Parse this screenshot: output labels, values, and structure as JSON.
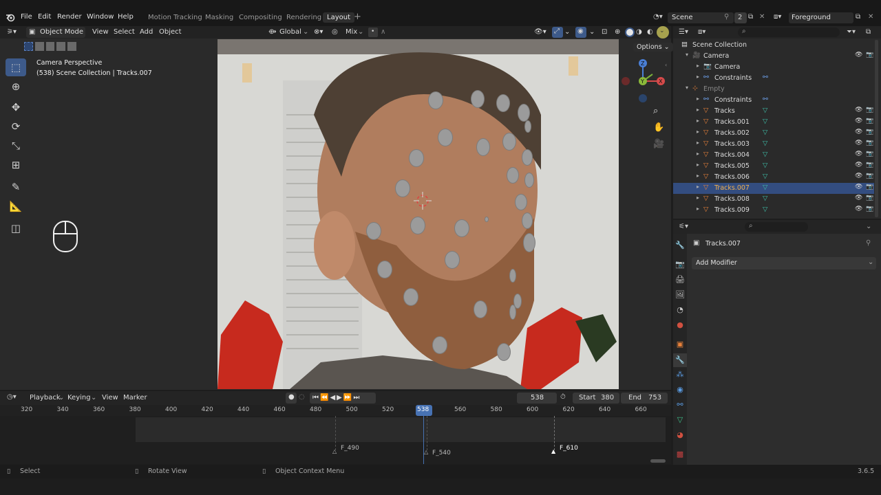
{
  "menu": [
    "File",
    "Edit",
    "Render",
    "Window",
    "Help"
  ],
  "workspaces": [
    "Motion Tracking",
    "Masking",
    "Compositing",
    "Rendering",
    "Layout"
  ],
  "active_workspace": "Layout",
  "scene": {
    "name": "Scene",
    "users": "2"
  },
  "view_layer": "Foreground",
  "viewport_header": {
    "mode": "Object Mode",
    "view": "View",
    "select": "Select",
    "add": "Add",
    "object": "Object",
    "transform_orientation": "Global",
    "pivot_mix": "Mix",
    "options": "Options"
  },
  "viewport_overlay": {
    "title": "Camera Perspective",
    "subtitle": "(538) Scene Collection | Tracks.007"
  },
  "outliner": {
    "rows": [
      {
        "label": "Scene Collection",
        "indent": 0,
        "icon": "collection-icon",
        "selected": false,
        "muted": false
      },
      {
        "label": "Camera",
        "indent": 1,
        "icon": "camera-object-icon",
        "selected": false,
        "muted": false
      },
      {
        "label": "Camera",
        "indent": 2,
        "icon": "camera-data-icon",
        "selected": false,
        "muted": false
      },
      {
        "label": "Constraints",
        "indent": 2,
        "icon": "constraint-icon",
        "selected": false,
        "muted": false
      },
      {
        "label": "Empty",
        "indent": 1,
        "icon": "empty-icon",
        "selected": false,
        "muted": true
      },
      {
        "label": "Constraints",
        "indent": 2,
        "icon": "constraint-icon",
        "selected": false,
        "muted": false
      },
      {
        "label": "Tracks",
        "indent": 2,
        "icon": "mesh-icon",
        "selected": false,
        "muted": false
      },
      {
        "label": "Tracks.001",
        "indent": 2,
        "icon": "mesh-icon",
        "selected": false,
        "muted": false
      },
      {
        "label": "Tracks.002",
        "indent": 2,
        "icon": "mesh-icon",
        "selected": false,
        "muted": false
      },
      {
        "label": "Tracks.003",
        "indent": 2,
        "icon": "mesh-icon",
        "selected": false,
        "muted": false
      },
      {
        "label": "Tracks.004",
        "indent": 2,
        "icon": "mesh-icon",
        "selected": false,
        "muted": false
      },
      {
        "label": "Tracks.005",
        "indent": 2,
        "icon": "mesh-icon",
        "selected": false,
        "muted": false
      },
      {
        "label": "Tracks.006",
        "indent": 2,
        "icon": "mesh-icon",
        "selected": false,
        "muted": false
      },
      {
        "label": "Tracks.007",
        "indent": 2,
        "icon": "mesh-icon",
        "selected": true,
        "muted": false
      },
      {
        "label": "Tracks.008",
        "indent": 2,
        "icon": "mesh-icon",
        "selected": false,
        "muted": false
      },
      {
        "label": "Tracks.009",
        "indent": 2,
        "icon": "mesh-icon",
        "selected": false,
        "muted": false
      }
    ]
  },
  "properties": {
    "object_name": "Tracks.007",
    "add_modifier": "Add Modifier"
  },
  "timeline": {
    "menus": [
      "Playback",
      "Keying",
      "View",
      "Marker"
    ],
    "current_frame": "538",
    "start_label": "Start",
    "start": "380",
    "end_label": "End",
    "end": "753",
    "ticks": [
      "320",
      "340",
      "360",
      "380",
      "400",
      "420",
      "440",
      "460",
      "480",
      "500",
      "520",
      "540",
      "560",
      "580",
      "600",
      "620",
      "640",
      "660"
    ],
    "markers": [
      "F_490",
      "F_540",
      "F_610"
    ]
  },
  "status": {
    "select": "Select",
    "rotate": "Rotate View",
    "context": "Object Context Menu",
    "version": "3.6.5"
  },
  "colors": {
    "accent": "#4772b3",
    "selected_row": "#334d80",
    "mesh_orange": "#e8813a"
  }
}
